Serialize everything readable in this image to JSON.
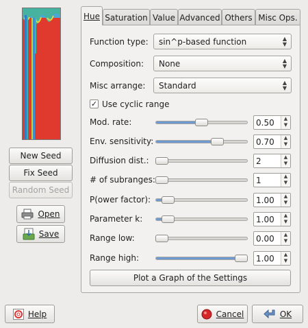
{
  "left_panel": {
    "new_seed": "New Seed",
    "fix_seed": "Fix Seed",
    "random_seed": "Random Seed",
    "open": "Open",
    "save": "Save"
  },
  "tabs": [
    {
      "label": "Hue",
      "active": true
    },
    {
      "label": "Saturation"
    },
    {
      "label": "Value"
    },
    {
      "label": "Advanced"
    },
    {
      "label": "Others"
    },
    {
      "label": "Misc Ops."
    }
  ],
  "hue": {
    "function_type": {
      "label": "Function type:",
      "value": "sin^p-based function"
    },
    "composition": {
      "label": "Composition:",
      "value": "None"
    },
    "misc_arrange": {
      "label": "Misc arrange:",
      "value": "Standard"
    },
    "use_cyclic_range": {
      "label": "Use cyclic range",
      "checked": true
    },
    "params": [
      {
        "label": "Mod. rate:",
        "value": "0.50",
        "fraction": 0.5
      },
      {
        "label": "Env. sensitivity:",
        "value": "0.70",
        "fraction": 0.7
      },
      {
        "label": "Diffusion dist.:",
        "value": "2",
        "fraction": 0.0
      },
      {
        "label": "# of subranges:",
        "value": "1",
        "fraction": 0.0
      },
      {
        "label": "P(ower factor):",
        "value": "1.00",
        "fraction": 0.08
      },
      {
        "label": "Parameter k:",
        "value": "1.00",
        "fraction": 0.08
      },
      {
        "label": "Range low:",
        "value": "0.00",
        "fraction": 0.0
      },
      {
        "label": "Range high:",
        "value": "1.00",
        "fraction": 1.0
      }
    ],
    "plot_button": "Plot a Graph of the Settings"
  },
  "footer": {
    "help": "Help",
    "cancel": "Cancel",
    "ok": "OK"
  },
  "colors": {
    "accent": "#6f9ad1",
    "preview_red": "#e03a2e"
  }
}
